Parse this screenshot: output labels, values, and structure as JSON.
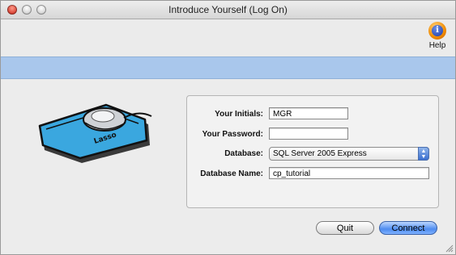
{
  "window": {
    "title": "Introduce Yourself (Log On)"
  },
  "toolbar": {
    "help_label": "Help",
    "help_icon_glyph": "i"
  },
  "logo": {
    "text": "Lasso"
  },
  "form": {
    "initials": {
      "label": "Your Initials:",
      "value": "MGR"
    },
    "password": {
      "label": "Your Password:",
      "value": ""
    },
    "database": {
      "label": "Database:",
      "selected": "SQL Server 2005 Express"
    },
    "database_name": {
      "label": "Database Name:",
      "value": "cp_tutorial"
    }
  },
  "buttons": {
    "quit": "Quit",
    "connect": "Connect"
  },
  "colors": {
    "banner": "#a9c7ec",
    "accent": "#4e8cf0"
  }
}
